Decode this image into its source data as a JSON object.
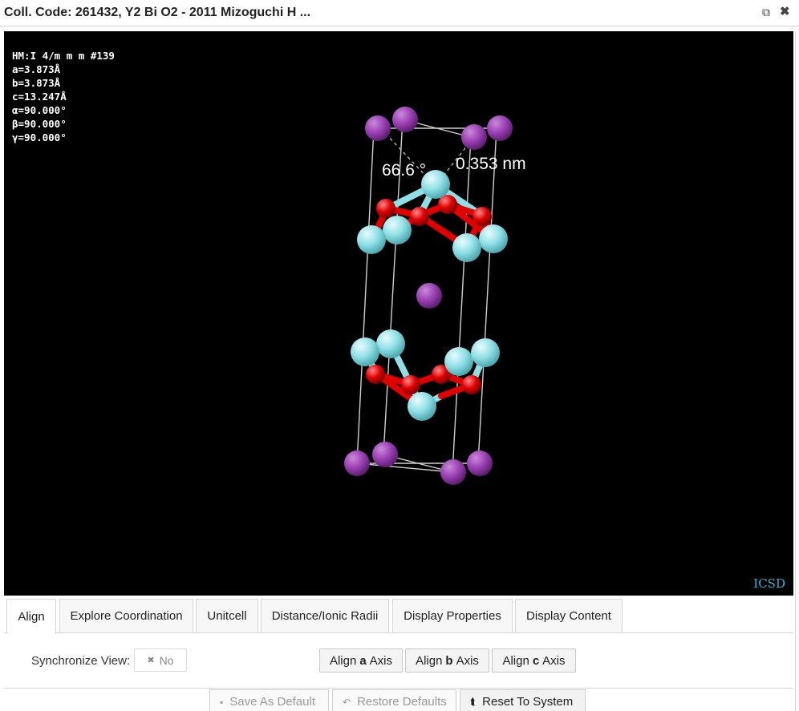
{
  "window": {
    "title": "Coll. Code: 261432, Y2 Bi O2 - 2011 Mizoguchi H ...",
    "popout_icon": "external-link-icon",
    "close_icon": "close-icon",
    "popout_glyph": "⧉",
    "close_glyph": "✖"
  },
  "viewer": {
    "cell_info": [
      "HM:I 4/m m m #139",
      "a=3.873Å",
      "b=3.873Å",
      "c=13.247Å",
      "α=90.000°",
      "β=90.000°",
      "γ=90.000°"
    ],
    "angle_label": "66.6 °",
    "distance_label": "0.353 nm",
    "logo": "ICSD",
    "colors": {
      "background": "#000000",
      "bismuth": "#9b40b4",
      "yttrium": "#8fe0e6",
      "oxygen": "#e00000",
      "bond": "#e6e6e6",
      "label": "#ffffff",
      "logo": "#3ab0d8"
    }
  },
  "tabs": [
    {
      "label": "Align",
      "active": true
    },
    {
      "label": "Explore Coordination",
      "active": false
    },
    {
      "label": "Unitcell",
      "active": false
    },
    {
      "label": "Distance/Ionic Radii",
      "active": false
    },
    {
      "label": "Display Properties",
      "active": false
    },
    {
      "label": "Display Content",
      "active": false
    }
  ],
  "align": {
    "sync_label": "Synchronize View:",
    "sync_value": "No",
    "sync_icon_glyph": "✖",
    "axis_prefix": "Align",
    "axis_suffix": "Axis",
    "axes": [
      "a",
      "b",
      "c"
    ]
  },
  "footer": {
    "save_default": "Save As Default",
    "restore_defaults": "Restore Defaults",
    "reset_system": "Reset To System",
    "save_glyph": "▪",
    "restore_glyph": "↶",
    "reset_glyph": "⮬"
  }
}
